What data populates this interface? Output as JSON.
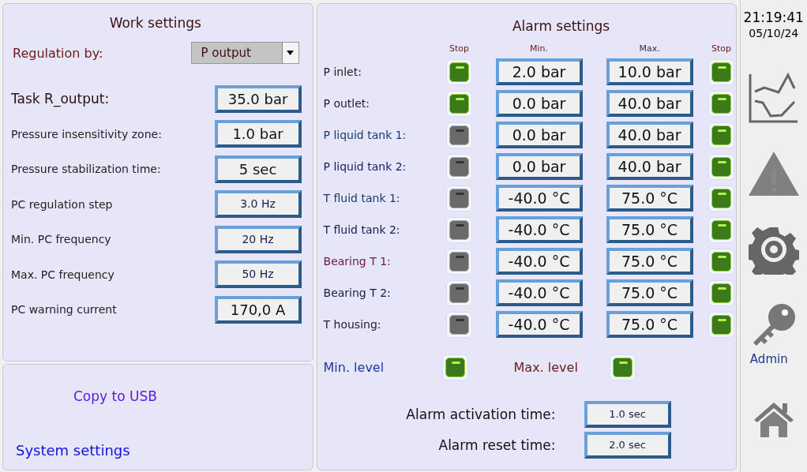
{
  "work_settings": {
    "title": "Work settings",
    "regulation": {
      "label": "Regulation by:",
      "value": "P output"
    },
    "fields": [
      {
        "label": "Task R_output:",
        "value": "35.0 bar",
        "kind": "large"
      },
      {
        "label": "Pressure insensitivity zone:",
        "value": "1.0 bar",
        "kind": "large"
      },
      {
        "label": "Pressure stabilization time:",
        "value": "5 sec",
        "kind": "large"
      },
      {
        "label": "PC regulation step",
        "value": "3.0 Hz",
        "kind": "small"
      },
      {
        "label": "Min. PC frequency",
        "value": "20 Hz",
        "kind": "small"
      },
      {
        "label": "Max. PC frequency",
        "value": "50 Hz",
        "kind": "small"
      },
      {
        "label": "PC warning current",
        "value": "170,0 A",
        "kind": "large"
      }
    ]
  },
  "links": [
    {
      "label": "Copy to USB"
    },
    {
      "label": "System settings"
    }
  ],
  "alarm_settings": {
    "title": "Alarm settings",
    "columns": [
      "Stop",
      "Min.",
      "Max.",
      "Stop"
    ],
    "rows": [
      {
        "label": "P inlet:",
        "color": "#222222",
        "min_stop": true,
        "min": "2.0 bar",
        "max": "10.0 bar",
        "max_stop": true
      },
      {
        "label": "P outlet:",
        "color": "#222222",
        "min_stop": true,
        "min": "0.0 bar",
        "max": "40.0 bar",
        "max_stop": true
      },
      {
        "label": "P liquid tank 1:",
        "color": "#1a3a6a",
        "min_stop": false,
        "min": "0.0 bar",
        "max": "40.0 bar",
        "max_stop": true
      },
      {
        "label": "P liquid tank 2:",
        "color": "#1a1a6a",
        "min_stop": false,
        "min": "0.0 bar",
        "max": "40.0 bar",
        "max_stop": true
      },
      {
        "label": "T fluid tank 1:",
        "color": "#1a3a6a",
        "min_stop": false,
        "min": "-40.0 °C",
        "max": "75.0 °C",
        "max_stop": true
      },
      {
        "label": "T fluid tank 2:",
        "color": "#1a1a4a",
        "min_stop": false,
        "min": "-40.0 °C",
        "max": "75.0 °C",
        "max_stop": true
      },
      {
        "label": "Bearing T 1:",
        "color": "#6a1a4a",
        "min_stop": false,
        "min": "-40.0 °C",
        "max": "75.0 °C",
        "max_stop": true
      },
      {
        "label": "Bearing T 2:",
        "color": "#1a1a4a",
        "min_stop": false,
        "min": "-40.0 °C",
        "max": "75.0 °C",
        "max_stop": true
      },
      {
        "label": "T housing:",
        "color": "#222222",
        "min_stop": false,
        "min": "-40.0 °C",
        "max": "75.0 °C",
        "max_stop": true
      }
    ],
    "levels": [
      {
        "label": "Min. level",
        "color": "#1a3aa0",
        "on": true
      },
      {
        "label": "Max. level",
        "color": "#6a1a1a",
        "on": true
      }
    ],
    "times": [
      {
        "label": "Alarm activation time:",
        "value": "1.0 sec"
      },
      {
        "label": "Alarm reset time:",
        "value": "2.0 sec"
      }
    ]
  },
  "sidebar": {
    "time": "21:19:41",
    "date": "05/10/24",
    "user": "Admin"
  }
}
